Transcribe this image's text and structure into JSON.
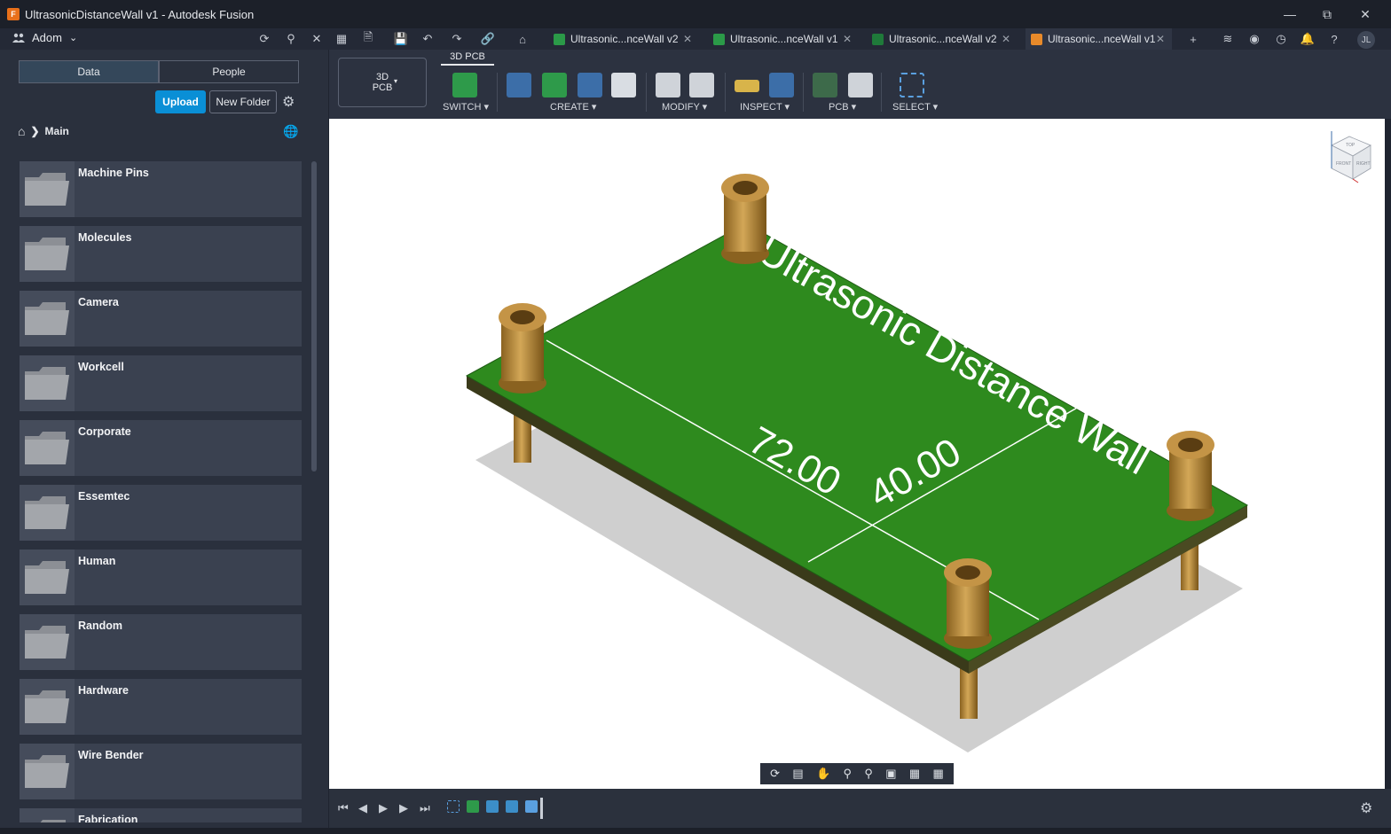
{
  "window": {
    "title": "UltrasonicDistanceWall v1 - Autodesk Fusion"
  },
  "toolbar": {
    "team_name": "Adom",
    "avatar_initials": "JL"
  },
  "tabs": [
    {
      "label": "Ultrasonic...nceWall v2",
      "icon": "schematic-icon"
    },
    {
      "label": "Ultrasonic...nceWall v1",
      "icon": "schematic-icon"
    },
    {
      "label": "Ultrasonic...nceWall v2",
      "icon": "pcb-icon"
    },
    {
      "label": "Ultrasonic...nceWall v1",
      "icon": "3d-pcb-icon",
      "active": true
    }
  ],
  "data_panel": {
    "tabs": [
      "Data",
      "People"
    ],
    "upload_label": "Upload",
    "new_folder_label": "New Folder",
    "breadcrumb": "Main",
    "folders": [
      "Machine Pins",
      "Molecules",
      "Camera",
      "Workcell",
      "Corporate",
      "Essemtec",
      "Human",
      "Random",
      "Hardware",
      "Wire Bender",
      "Fabrication"
    ]
  },
  "ribbon": {
    "workspace_line1": "3D",
    "workspace_line2": "PCB",
    "active_tab": "3D PCB",
    "groups": [
      "SWITCH",
      "CREATE",
      "MODIFY",
      "INSPECT",
      "PCB",
      "SELECT"
    ]
  },
  "viewport": {
    "board_text": "Ultrasonic Distance Wall",
    "dimension_length": "72.00",
    "dimension_width": "40.00",
    "board_color": "#2e8a1e",
    "viewcube_faces": {
      "top": "TOP",
      "front": "FRONT",
      "right": "RIGHT"
    }
  },
  "colors": {
    "accent": "#0a8fd6",
    "board": "#2e8a1e",
    "standoff": "#b8893a"
  }
}
